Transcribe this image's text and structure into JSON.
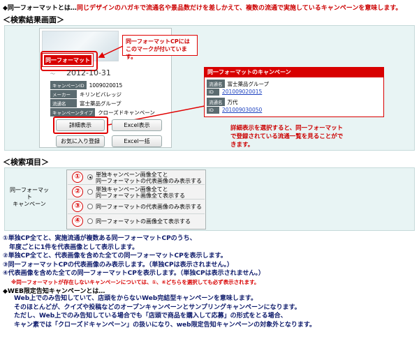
{
  "intro": {
    "term": "◆同一フォーマットとは…",
    "definition": "同じデザインのハガキで流通名や景品数だけを差しかえて、複数の流通で実施しているキャンペーンを意味します。"
  },
  "sections": {
    "result_heading": "＜検索結果画面＞",
    "items_heading": "＜検索項目＞"
  },
  "card": {
    "badge": "同一フォーマット",
    "callout_line1": "同一フォーマットCPには",
    "callout_line2": "このマークが付いています。",
    "date_prefix": "〜",
    "date": "2012-10-31",
    "rows": [
      {
        "label": "キャンペーンID",
        "value": "1009020015"
      },
      {
        "label": "メーカー",
        "value": "キリンビバレッジ"
      },
      {
        "label": "流通名",
        "value": "富士薬品グループ"
      },
      {
        "label": "キャンペーンタイプ",
        "value": "クローズドキャンペーン"
      }
    ],
    "buttons": {
      "detail": "詳細表示",
      "excel": "Excel表示",
      "favorite": "お気に入り登録",
      "excel_all": "Excel一括"
    }
  },
  "detail": {
    "title": "同一フォーマットのキャンペーン",
    "rows": [
      {
        "label": "流通名",
        "value": "富士薬品グループ",
        "link": false
      },
      {
        "label": "ID",
        "value": "201009020015",
        "link": true
      },
      {
        "label": "流通名",
        "value": "万代",
        "link": false
      },
      {
        "label": "ID",
        "value": "201009030050",
        "link": true
      }
    ]
  },
  "detail_note": {
    "line1": "詳細表示を選択すると、同一フォーマット",
    "line2": "で登録されている流通一覧を見ることがで",
    "line3": "きます。"
  },
  "filter": {
    "label_line1": "同一フォーマッ",
    "label_line2": "ト",
    "label_line3": "キャンペーン",
    "options": [
      {
        "num": "①",
        "line1": "単独キャンペーン画像全てと",
        "line2": "同一フォーマットの代表画像のみ表示する",
        "selected": true
      },
      {
        "num": "②",
        "line1": "単独キャンペーン画像全てと",
        "line2": "同一フォーマット画像全て表示する",
        "selected": false
      },
      {
        "num": "③",
        "line1": "同一フォーマットの代表画像のみ表示する",
        "line2": "",
        "selected": false
      },
      {
        "num": "④",
        "line1": "同一フォーマットの画像全て表示する",
        "line2": "",
        "selected": false
      }
    ]
  },
  "explanations": {
    "e1a": "①単独CP全てと、実施流通が複数ある同一フォーマットCPのうち、",
    "e1b": "　年度ごとに1件を代表画像として表示します。",
    "e2": "②単独CP全てと、代表画像を含めた全ての同一フォーマットCPを表示します。",
    "e3": "③同一フォーマットCPの代表画像のみ表示します。（単独CPは表示されません。）",
    "e4": "④代表画像を含めた全ての同一フォーマットCPを表示します。（単独CPは表示されません。）",
    "note": "※同一フォーマットが存在しないキャンペーンについては、①、④どちらを選択しても必ず表示されます。"
  },
  "web": {
    "title": "◆WEB限定告知キャンペーンとは…",
    "l1": "Web上でのみ告知していて、店頭をからないWeb完結型キャンペーンを意味します。",
    "l2": "そのほとんどが、クイズや投稿などのオープンキャンペーンとサンプリングキャンペーンになります。",
    "l3": "ただし、Web上でのみ告知している場合でも「店頭で商品を購入して応募」の形式をとる場合、",
    "l4": "キャン素では「クローズドキャンペーン」の扱いになり、web限定告知キャンペーンの対象外となります。"
  },
  "colors": {
    "accent_red": "#d80000",
    "panel_bg": "#e8f4f4",
    "text_navy": "#0d1a6b"
  }
}
